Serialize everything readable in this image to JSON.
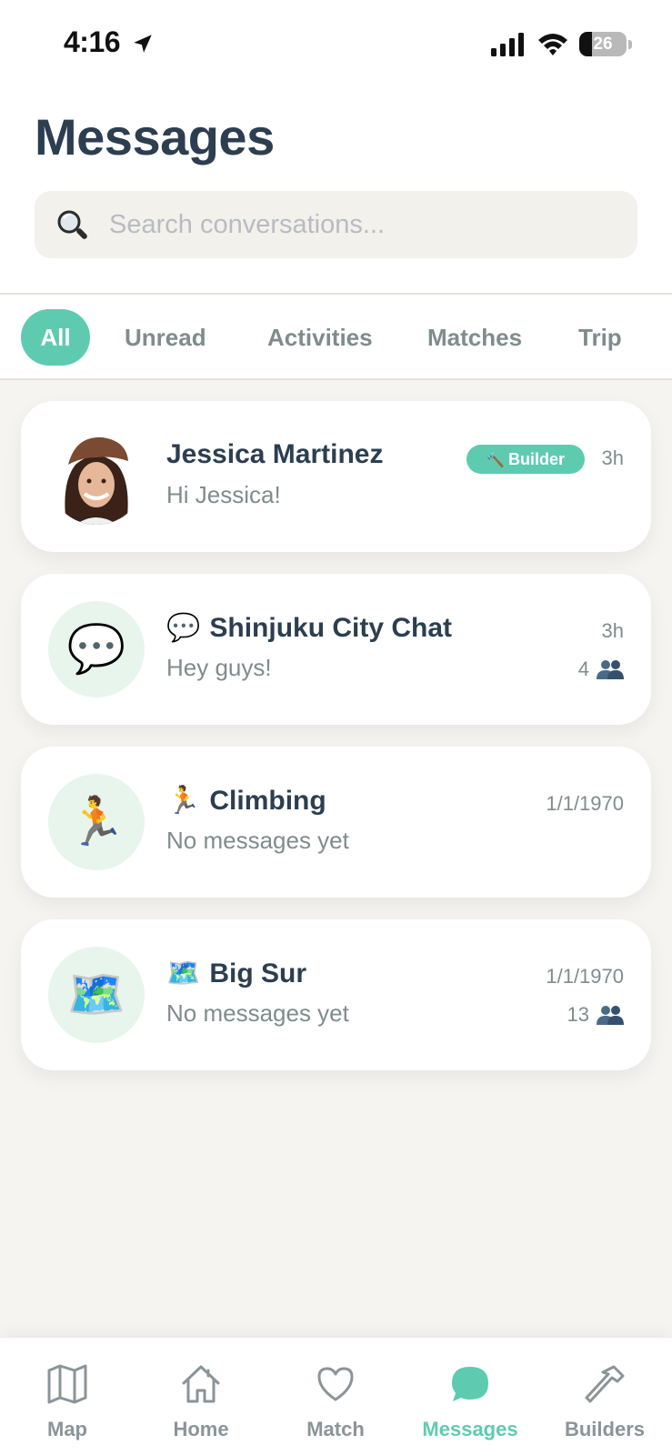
{
  "status_bar": {
    "time": "4:16",
    "battery": "26"
  },
  "header": {
    "title": "Messages"
  },
  "search": {
    "placeholder": "Search conversations..."
  },
  "filters": {
    "active": "All",
    "items": [
      "All",
      "Unread",
      "Activities",
      "Matches",
      "Trip"
    ]
  },
  "conversations": [
    {
      "name": "Jessica Martinez",
      "preview": "Hi Jessica!",
      "time": "3h",
      "badge": "Builder",
      "badge_icon": "hammer-icon",
      "avatar": "photo"
    },
    {
      "emoji": "💬",
      "name": "Shinjuku City Chat",
      "preview": "Hey guys!",
      "time": "3h",
      "members": "4",
      "avatar_icon": "speech-bubble-icon"
    },
    {
      "emoji": "🏃",
      "name": "Climbing",
      "preview": "No messages yet",
      "time": "1/1/1970",
      "avatar_icon": "runner-icon"
    },
    {
      "emoji": "🗺️",
      "name": "Big Sur",
      "preview": "No messages yet",
      "time": "1/1/1970",
      "members": "13",
      "avatar_icon": "world-map-icon"
    }
  ],
  "nav": {
    "active": "Messages",
    "items": [
      {
        "label": "Map",
        "icon": "map-icon"
      },
      {
        "label": "Home",
        "icon": "home-icon"
      },
      {
        "label": "Match",
        "icon": "heart-icon"
      },
      {
        "label": "Messages",
        "icon": "chat-bubble-icon"
      },
      {
        "label": "Builders",
        "icon": "hammer-icon"
      }
    ]
  },
  "colors": {
    "accent": "#5ecbb1",
    "title": "#2c3e50",
    "muted": "#7f8c8d",
    "background": "#f5f4f1",
    "avatar_bg": "#e8f5ec"
  }
}
